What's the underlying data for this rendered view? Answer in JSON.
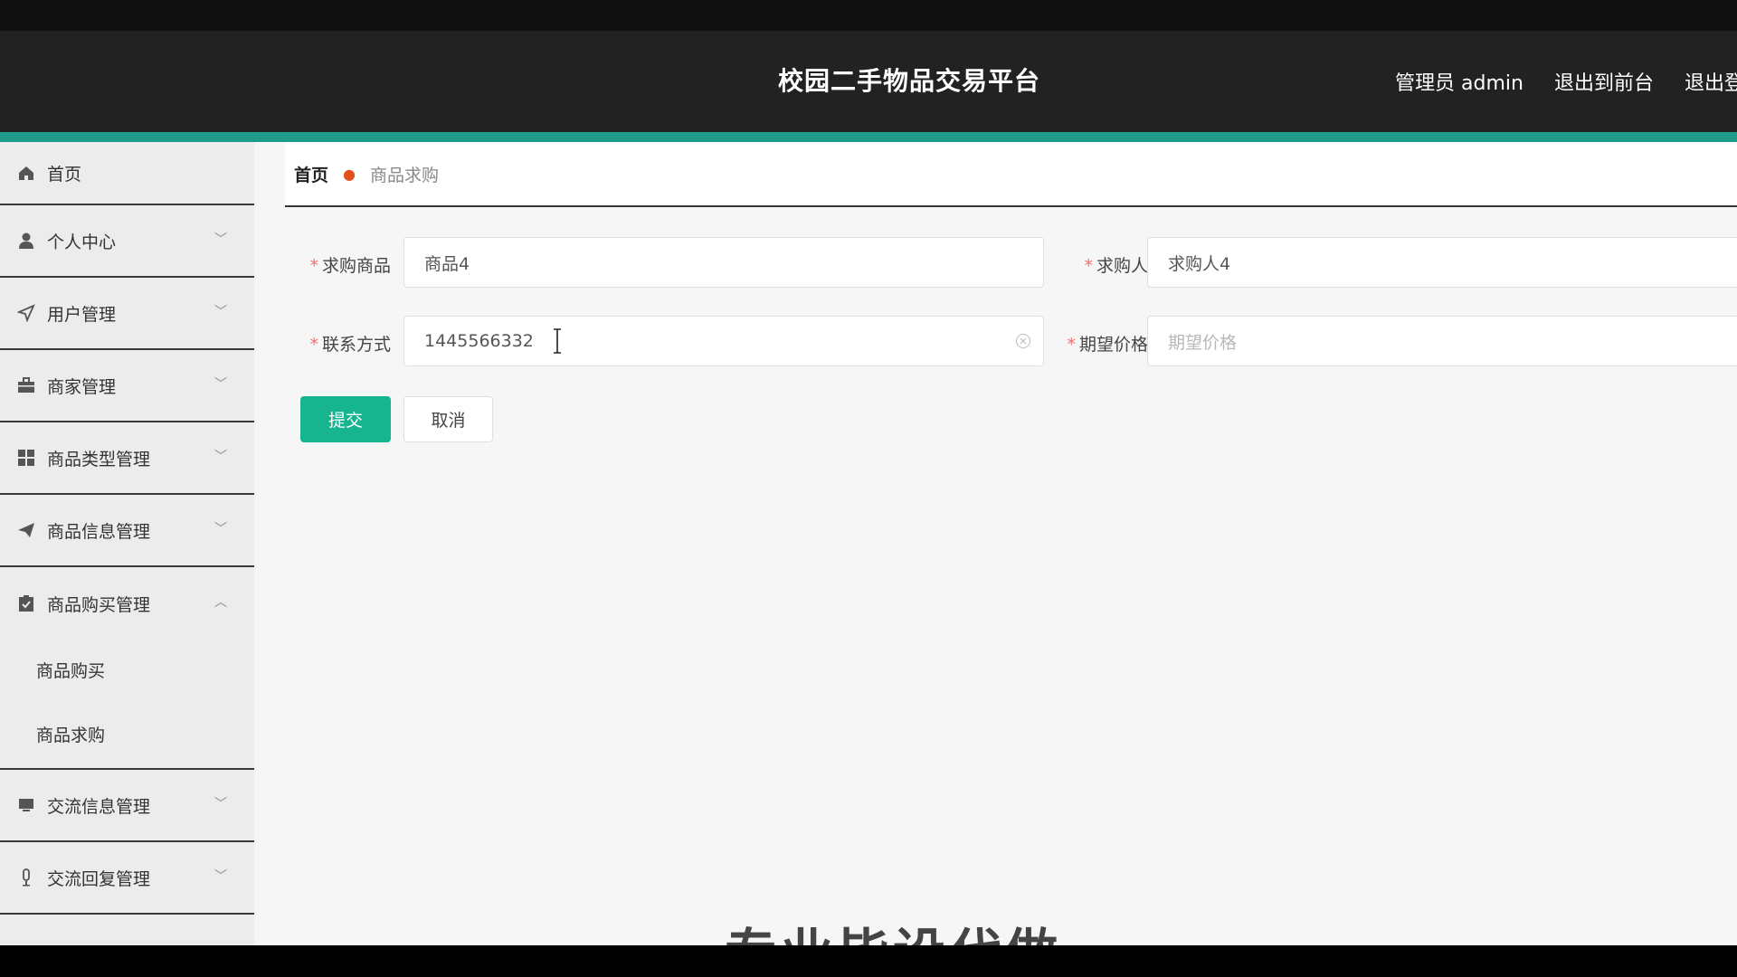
{
  "header": {
    "title": "校园二手物品交易平台",
    "admin_label": "管理员 admin",
    "to_front": "退出到前台",
    "logout": "退出登录"
  },
  "sidebar": {
    "items": [
      {
        "label": "首页",
        "icon": "home-icon"
      },
      {
        "label": "个人中心",
        "icon": "user-icon"
      },
      {
        "label": "用户管理",
        "icon": "send-icon"
      },
      {
        "label": "商家管理",
        "icon": "briefcase-icon"
      },
      {
        "label": "商品类型管理",
        "icon": "grid-icon"
      },
      {
        "label": "商品信息管理",
        "icon": "paper-plane-icon"
      },
      {
        "label": "商品购买管理",
        "icon": "clipboard-check-icon",
        "expanded": true,
        "children": [
          {
            "label": "商品购买"
          },
          {
            "label": "商品求购"
          }
        ]
      },
      {
        "label": "交流信息管理",
        "icon": "monitor-icon"
      },
      {
        "label": "交流回复管理",
        "icon": "microphone-icon"
      }
    ]
  },
  "breadcrumb": {
    "home": "首页",
    "current": "商品求购"
  },
  "form": {
    "product": {
      "label": "求购商品",
      "value": "商品4"
    },
    "buyer": {
      "label": "求购人",
      "value": "求购人4"
    },
    "contact": {
      "label": "联系方式",
      "value": "1445566332"
    },
    "price": {
      "label": "期望价格",
      "value": "",
      "placeholder": "期望价格"
    },
    "required_mark": "*",
    "submit_label": "提交",
    "cancel_label": "取消"
  },
  "watermark": "专业毕设代做",
  "colors": {
    "header_bg": "#222222",
    "accent": "#1d9c89",
    "submit_bg": "#16b58f",
    "breadcrumb_sep": "#e2501c",
    "required": "#f56c6c"
  }
}
